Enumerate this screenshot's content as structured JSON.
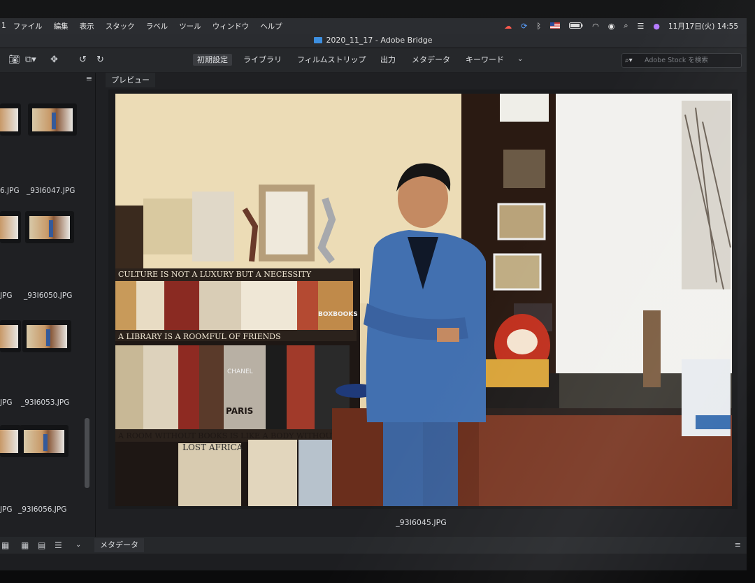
{
  "menubar": {
    "items": [
      "ファイル",
      "編集",
      "表示",
      "スタック",
      "ラベル",
      "ツール",
      "ウィンドウ",
      "ヘルプ"
    ],
    "status_icons": [
      "creative-cloud-icon",
      "sync-icon",
      "bluetooth-icon",
      "flag-us-icon",
      "battery-icon",
      "wifi-icon",
      "user-icon",
      "search-icon",
      "control-center-icon",
      "siri-icon"
    ],
    "clock": "11月17日(火)  14:55"
  },
  "window": {
    "title": "2020_11_17 - Adobe Bridge"
  },
  "toolbar": {
    "workspaces": [
      "初期設定",
      "ライブラリ",
      "フィルムストリップ",
      "出力",
      "メタデータ",
      "キーワード"
    ],
    "search_placeholder": "Adobe Stock を検索"
  },
  "content_panel": {
    "files": [
      {
        "name": "_93I6047.JPG",
        "left": "6.JPG"
      },
      {
        "name": "_93I6050.JPG",
        "left": "JPG"
      },
      {
        "name": "_93I6053.JPG",
        "left": "JPG"
      },
      {
        "name": "_93I6056.JPG",
        "left": "JPG"
      }
    ]
  },
  "preview": {
    "tab_label": "プレビュー",
    "file_name": "_93I6045.JPG"
  },
  "bottom": {
    "metadata_tab": "メタデータ"
  },
  "photo_text": {
    "shelf_top": "CULTURE IS NOT A LUXURY BUT A NECESSITY",
    "shelf_mid": "A LIBRARY IS A ROOMFUL OF FRIENDS",
    "shelf_low": "A ROOM WITHOUT BOOKS IS LIKE A BODY WITHOUT A",
    "book_lost_africa": "LOST AFRICA",
    "book_paris": "PARIS",
    "book_chanel": "CHANEL",
    "book_box": "BOXBOOKS"
  },
  "colors": {
    "accent_blue": "#3d8fe0",
    "panel_bg": "#1f2023",
    "suit": "#3f6aa6",
    "wall": "#e9d9b4"
  }
}
